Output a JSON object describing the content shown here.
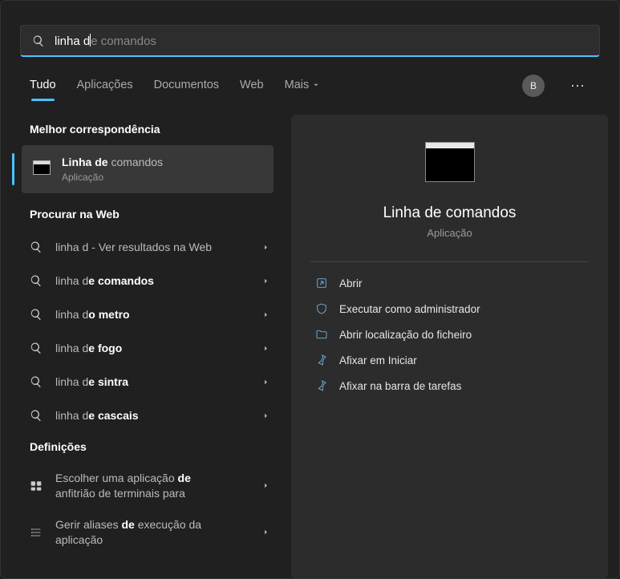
{
  "search": {
    "typed": "linha d",
    "ghost": "e comandos"
  },
  "tabs": {
    "all": "Tudo",
    "apps": "Aplicações",
    "docs": "Documentos",
    "web": "Web",
    "more": "Mais"
  },
  "avatar_letter": "B",
  "sections": {
    "best_match": "Melhor correspondência",
    "web_search": "Procurar na Web",
    "settings": "Definições"
  },
  "best": {
    "title_pre": "Linha de",
    "title_post": " comandos",
    "subtitle": "Aplicação"
  },
  "web_items": [
    {
      "pre": "linha d",
      "post": "",
      "extra": " - Ver resultados na Web"
    },
    {
      "pre": "linha d",
      "post": "e comandos",
      "extra": ""
    },
    {
      "pre": "linha d",
      "post": "o metro",
      "extra": ""
    },
    {
      "pre": "linha d",
      "post": "e fogo",
      "extra": ""
    },
    {
      "pre": "linha d",
      "post": "e sintra",
      "extra": ""
    },
    {
      "pre": "linha d",
      "post": "e cascais",
      "extra": ""
    }
  ],
  "settings_items": [
    {
      "line1_a": "Escolher uma aplicação ",
      "line1_b": "de",
      "line2": "anfitrião de terminais para"
    },
    {
      "line1_a": "Gerir aliases ",
      "line1_b": "de",
      "line1_c": " execução da",
      "line2": "aplicação"
    }
  ],
  "preview": {
    "title": "Linha de comandos",
    "subtitle": "Aplicação"
  },
  "actions": {
    "open": "Abrir",
    "admin": "Executar como administrador",
    "location": "Abrir localização do ficheiro",
    "pin_start": "Afixar em Iniciar",
    "pin_task": "Afixar na barra de tarefas"
  }
}
